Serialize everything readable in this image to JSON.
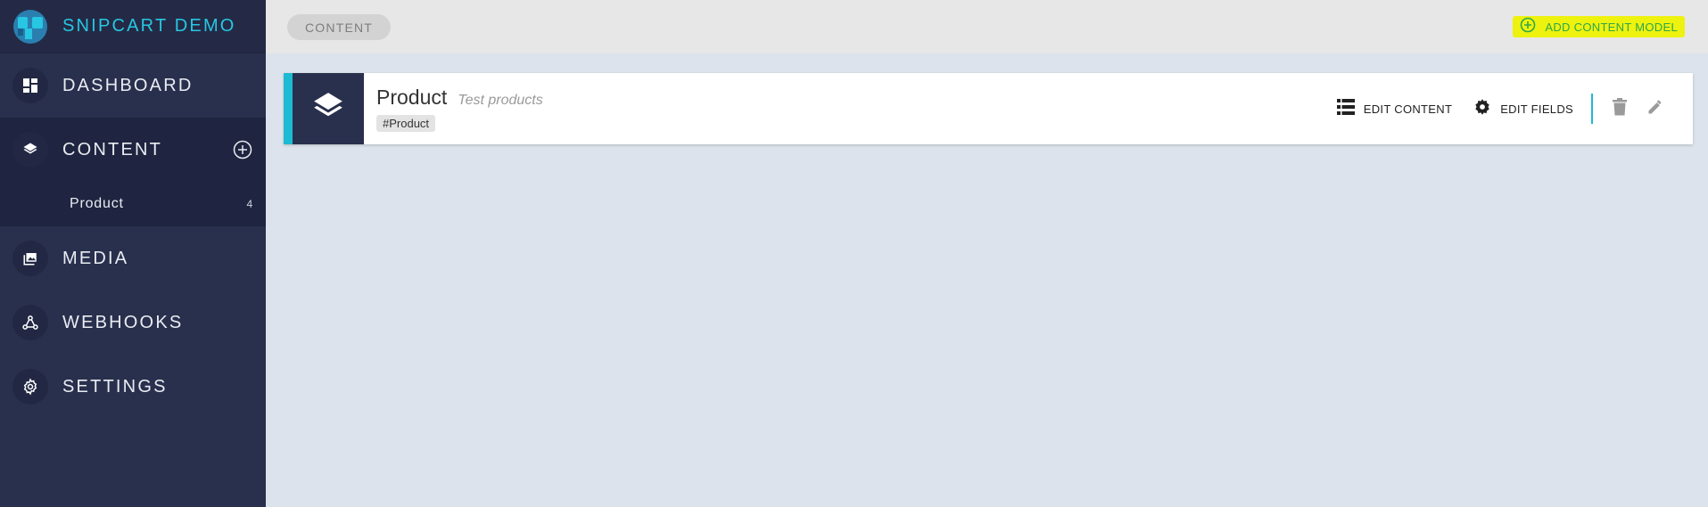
{
  "brand": {
    "name": "SNIPCART DEMO"
  },
  "sidebar": {
    "items": [
      {
        "label": "DASHBOARD",
        "icon": "dashboard-icon"
      },
      {
        "label": "CONTENT",
        "icon": "layers-icon"
      },
      {
        "label": "MEDIA",
        "icon": "images-icon"
      },
      {
        "label": "WEBHOOKS",
        "icon": "webhook-icon"
      },
      {
        "label": "SETTINGS",
        "icon": "gear-icon"
      }
    ],
    "content_children": [
      {
        "label": "Product",
        "count": "4"
      }
    ]
  },
  "header": {
    "breadcrumb": "CONTENT",
    "add_model_label": "ADD CONTENT MODEL"
  },
  "model": {
    "name": "Product",
    "description": "Test products",
    "tag": "#Product",
    "edit_content_label": "EDIT CONTENT",
    "edit_fields_label": "EDIT FIELDS"
  },
  "colors": {
    "sidebar_bg": "#29304d",
    "accent_cyan": "#1cbad3",
    "add_green": "#2ea84a",
    "highlight_yellow": "#eef20f"
  }
}
